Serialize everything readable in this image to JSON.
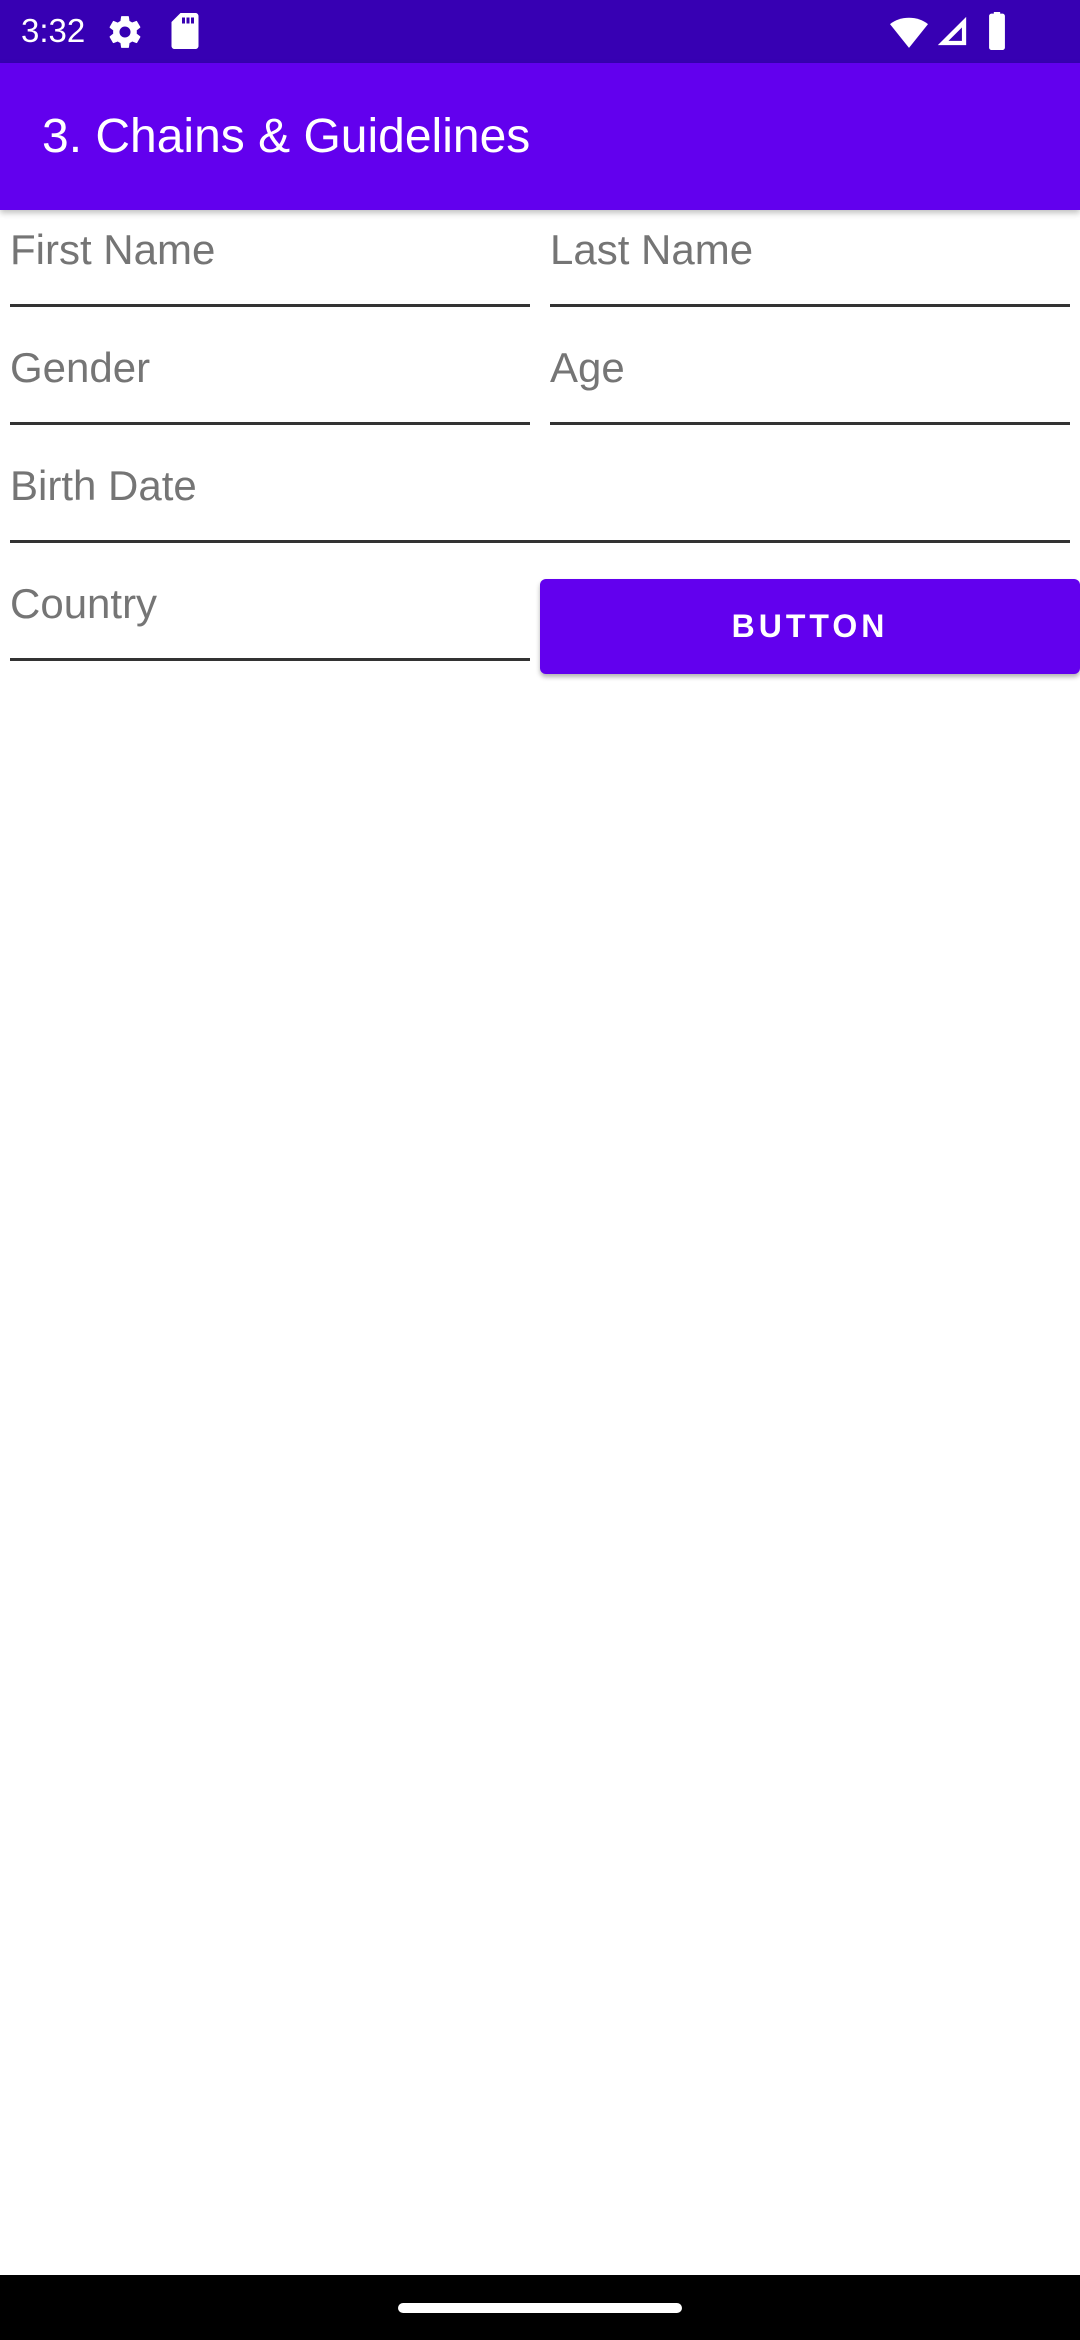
{
  "status_bar": {
    "time": "3:32",
    "icons": [
      "settings-gear-icon",
      "sd-card-icon",
      "wifi-icon",
      "cellular-signal-icon",
      "battery-icon"
    ]
  },
  "app_bar": {
    "title": "3. Chains & Guidelines",
    "color": "#6200ee"
  },
  "form": {
    "first_name": {
      "placeholder": "First Name",
      "value": ""
    },
    "last_name": {
      "placeholder": "Last Name",
      "value": ""
    },
    "gender": {
      "placeholder": "Gender",
      "value": ""
    },
    "age": {
      "placeholder": "Age",
      "value": ""
    },
    "birth_date": {
      "placeholder": "Birth Date",
      "value": ""
    },
    "country": {
      "placeholder": "Country",
      "value": ""
    },
    "button_label": "BUTTON"
  },
  "colors": {
    "status_bar": "#3700b3",
    "primary": "#6200ee",
    "nav_bar": "#000000"
  }
}
